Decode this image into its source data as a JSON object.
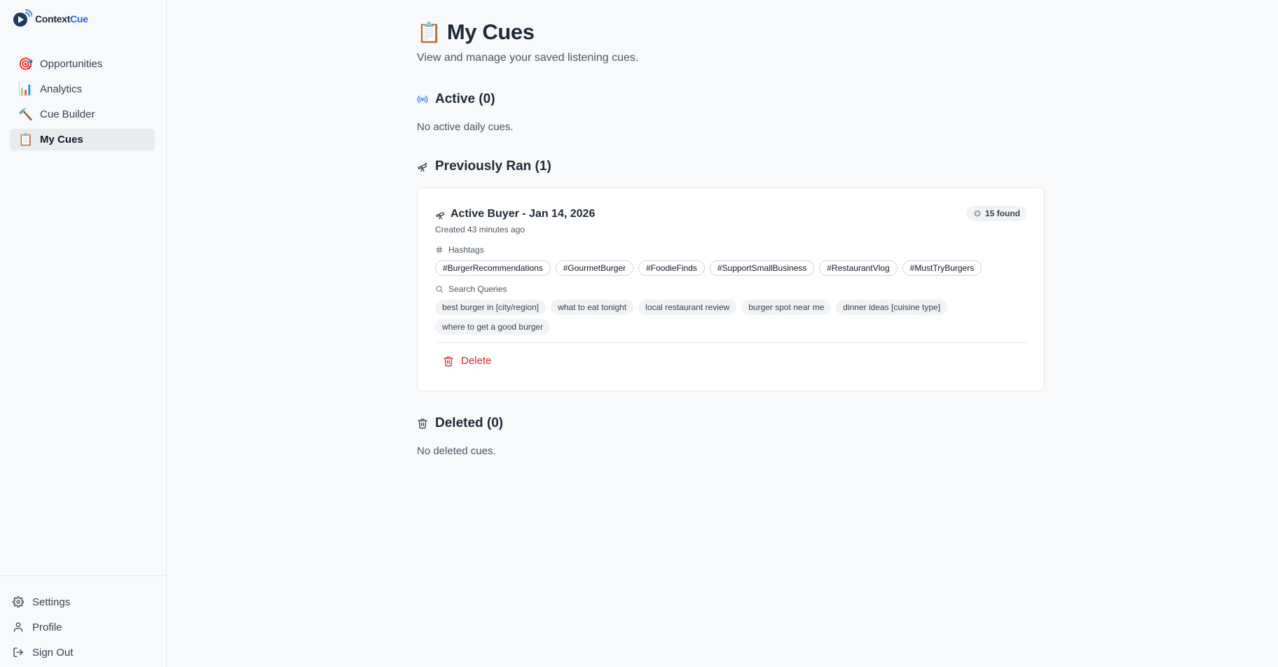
{
  "brand": {
    "name_part1": "Context",
    "name_part2": "Cue"
  },
  "sidebar": {
    "items": [
      {
        "label": "Opportunities",
        "icon": "🎯",
        "active": false
      },
      {
        "label": "Analytics",
        "icon": "📊",
        "active": false
      },
      {
        "label": "Cue Builder",
        "icon": "🔨",
        "active": false
      },
      {
        "label": "My Cues",
        "icon": "📋",
        "active": true
      }
    ],
    "bottom": [
      {
        "label": "Settings",
        "icon": "gear-icon"
      },
      {
        "label": "Profile",
        "icon": "user-icon"
      },
      {
        "label": "Sign Out",
        "icon": "sign-out-icon"
      }
    ]
  },
  "page": {
    "icon": "📋",
    "title": "My Cues",
    "subtitle": "View and manage your saved listening cues."
  },
  "sections": {
    "active": {
      "title": "Active (0)",
      "empty": "No active daily cues."
    },
    "previous": {
      "title": "Previously Ran (1)"
    },
    "deleted": {
      "title": "Deleted (0)",
      "empty": "No deleted cues."
    }
  },
  "cue": {
    "title": "Active Buyer - Jan 14, 2026",
    "found": "15 found",
    "created": "Created 43 minutes ago",
    "hashtags_label": "Hashtags",
    "hashtags": [
      "#BurgerRecommendations",
      "#GourmetBurger",
      "#FoodieFinds",
      "#SupportSmallBusiness",
      "#RestaurantVlog",
      "#MustTryBurgers"
    ],
    "queries_label": "Search Queries",
    "queries_row1": [
      "best burger in [city/region]",
      "what to eat tonight",
      "local restaurant review",
      "burger spot near me",
      "dinner ideas [cuisine type]"
    ],
    "queries_row2": [
      "where to get a good burger"
    ],
    "delete_label": "Delete"
  },
  "colors": {
    "accent": "#2563eb",
    "danger": "#dc2626",
    "radar": "#3b82f6"
  }
}
